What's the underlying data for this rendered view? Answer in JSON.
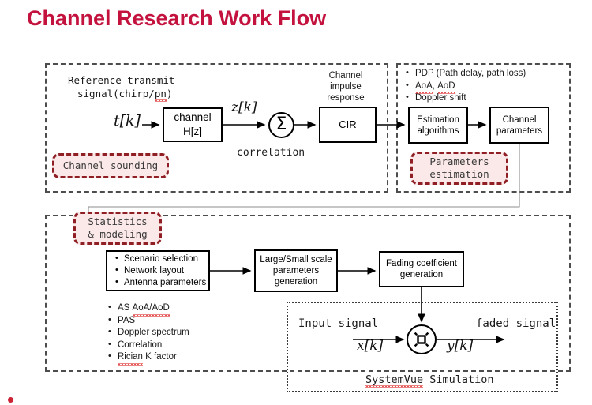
{
  "slide": {
    "title": "Channel Research Work Flow",
    "title_color": "#c4123f"
  },
  "sections": {
    "channel_sounding": {
      "badge_label": "Channel sounding",
      "caption_top": "Reference transmit",
      "caption_top2": "signal(chirp/pn)",
      "input_signal": "t[k]",
      "channel_box_line1": "channel",
      "channel_box_line2": "H[z]",
      "mid_signal": "z[k]",
      "correlation_label": "correlation",
      "correlation_symbol": "Σ",
      "cir_caption_l1": "Channel",
      "cir_caption_l2": "impulse",
      "cir_caption_l3": "response",
      "cir_box": "CIR"
    },
    "parameters_estimation": {
      "badge_line1": "Parameters",
      "badge_line2": "estimation",
      "bullets": [
        "PDP (Path delay, path loss)",
        "AoA, AoD",
        "Doppler shift"
      ],
      "estimation_box_l1": "Estimation",
      "estimation_box_l2": "algorithms",
      "channel_params_box_l1": "Channel",
      "channel_params_box_l2": "parameters"
    },
    "statistics_modeling": {
      "badge_line1": "Statistics",
      "badge_line2": "& modeling",
      "scenario_box_bullets": [
        "Scenario selection",
        "Network layout",
        "Antenna parameters"
      ],
      "lsp_box_l1": "Large/Small scale",
      "lsp_box_l2": "parameters",
      "lsp_box_l3": "generation",
      "fading_box_l1": "Fading coefficient",
      "fading_box_l2": "generation",
      "stat_bullets": [
        "AS AoA/AoD",
        "PAS",
        "Doppler spectrum",
        "Correlation",
        "Rician K factor"
      ]
    },
    "systemvue": {
      "input_label": "Input signal",
      "input_signal": "x[k]",
      "output_label": "faded signal",
      "output_signal": "y[k]",
      "operator_symbol": "convolution-operator",
      "caption": "SystemVue Simulation"
    }
  },
  "colors": {
    "title": "#c4123f",
    "badge_border": "#8f1f24",
    "badge_fill": "#fbe8e8",
    "group_border": "#4d4d4d",
    "box_border": "#000000",
    "spellcheck_underline": "#e03a3a"
  }
}
